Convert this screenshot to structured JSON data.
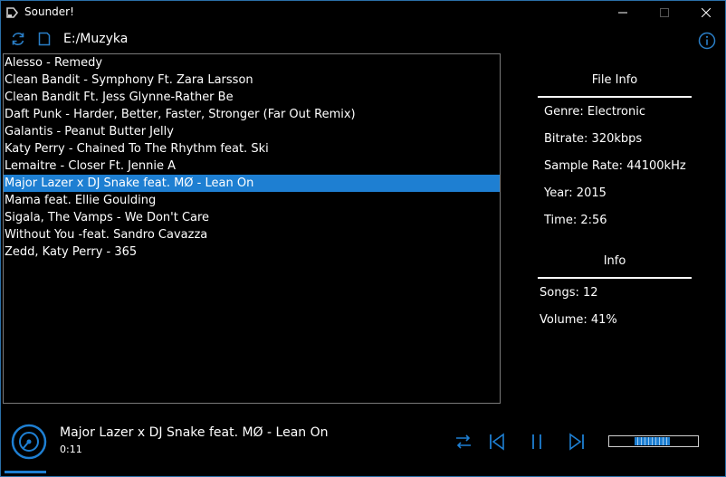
{
  "window": {
    "title": "Sounder!"
  },
  "toolbar": {
    "path": "E:/Muzyka"
  },
  "songs": [
    "Alesso - Remedy",
    "Clean Bandit - Symphony Ft. Zara Larsson",
    "Clean Bandit Ft. Jess Glynne-Rather Be",
    "Daft Punk - Harder, Better, Faster, Stronger (Far Out Remix)",
    "Galantis - Peanut Butter Jelly",
    "Katy Perry - Chained To The Rhythm feat. Ski",
    "Lemaitre - Closer Ft. Jennie A",
    "Major Lazer x DJ Snake feat. MØ - Lean On",
    "Mama feat. Ellie Goulding",
    "Sigala, The Vamps - We Don't Care",
    "Without You -feat. Sandro Cavazza",
    "Zedd, Katy Perry - 365"
  ],
  "selected_index": 7,
  "file_info": {
    "heading": "File Info",
    "genre": "Genre: Electronic",
    "bitrate": "Bitrate: 320kbps",
    "sample_rate": "Sample Rate: 44100kHz",
    "year": "Year: 2015",
    "time": "Time: 2:56"
  },
  "info": {
    "heading": "Info",
    "songs": "Songs: 12",
    "volume": "Volume: 41%"
  },
  "player": {
    "title": "Major Lazer x DJ Snake feat. MØ - Lean On",
    "position": "0:11",
    "volume_fraction": 0.41
  },
  "colors": {
    "accent": "#1e7fd2",
    "background": "#000000",
    "text": "#ffffff"
  },
  "icons": {
    "app": "music-app-icon",
    "refresh": "refresh-icon",
    "folder": "folder-icon",
    "info": "info-icon",
    "shuffle": "shuffle-icon",
    "previous": "previous-icon",
    "pause": "pause-icon",
    "next": "next-icon",
    "disc": "disc-icon"
  }
}
